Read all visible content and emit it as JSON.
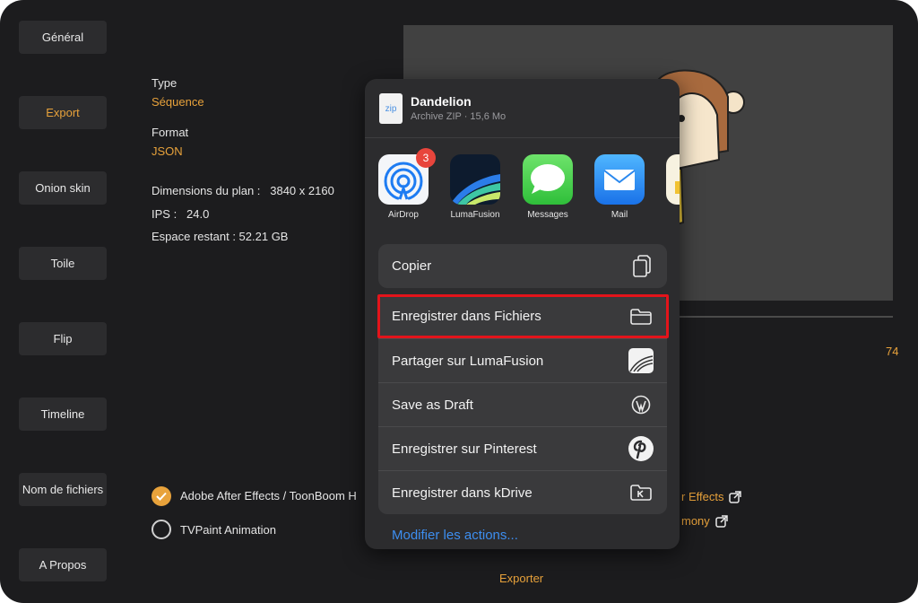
{
  "sidebar": {
    "items": [
      {
        "label": "Général"
      },
      {
        "label": "Export"
      },
      {
        "label": "Onion skin"
      },
      {
        "label": "Toile"
      },
      {
        "label": "Flip"
      },
      {
        "label": "Timeline"
      },
      {
        "label": "Nom de fichiers"
      },
      {
        "label": "A Propos"
      }
    ],
    "active_index": 1
  },
  "info": {
    "type_label": "Type",
    "type_value": "Séquence",
    "format_label": "Format",
    "format_value": "JSON",
    "dimensions": "Dimensions du plan :   3840 x 2160",
    "fps": "IPS :   24.0",
    "space": "Espace restant : 52.21 GB"
  },
  "preview": {
    "frame_count": "74"
  },
  "options": [
    {
      "label": "Adobe After Effects / ToonBoom H",
      "checked": true
    },
    {
      "label": "TVPaint Animation",
      "checked": false
    }
  ],
  "links": [
    {
      "label": "r Effects"
    },
    {
      "label": "mony"
    }
  ],
  "exporter_label": "Exporter",
  "share_sheet": {
    "file_icon": "zip",
    "file_name": "Dandelion",
    "file_meta": "Archive ZIP · 15,6 Mo",
    "apps": [
      {
        "label": "AirDrop",
        "icon": "airdrop-icon",
        "badge": "3"
      },
      {
        "label": "LumaFusion",
        "icon": "lumafusion-icon"
      },
      {
        "label": "Messages",
        "icon": "messages-icon"
      },
      {
        "label": "Mail",
        "icon": "mail-icon"
      }
    ],
    "copy_label": "Copier",
    "actions": [
      {
        "label": "Enregistrer dans Fichiers",
        "icon": "folder-icon"
      },
      {
        "label": "Partager sur LumaFusion",
        "icon": "lumafusion-icon"
      },
      {
        "label": "Save as Draft",
        "icon": "wordpress-icon"
      },
      {
        "label": "Enregistrer sur Pinterest",
        "icon": "pinterest-icon"
      },
      {
        "label": "Enregistrer dans kDrive",
        "icon": "kdrive-icon"
      }
    ],
    "modify_label": "Modifier les actions..."
  },
  "colors": {
    "accent": "#e8a23b",
    "background": "#1c1c1e",
    "highlight": "#e3141b",
    "link_blue": "#3d8ef0"
  }
}
